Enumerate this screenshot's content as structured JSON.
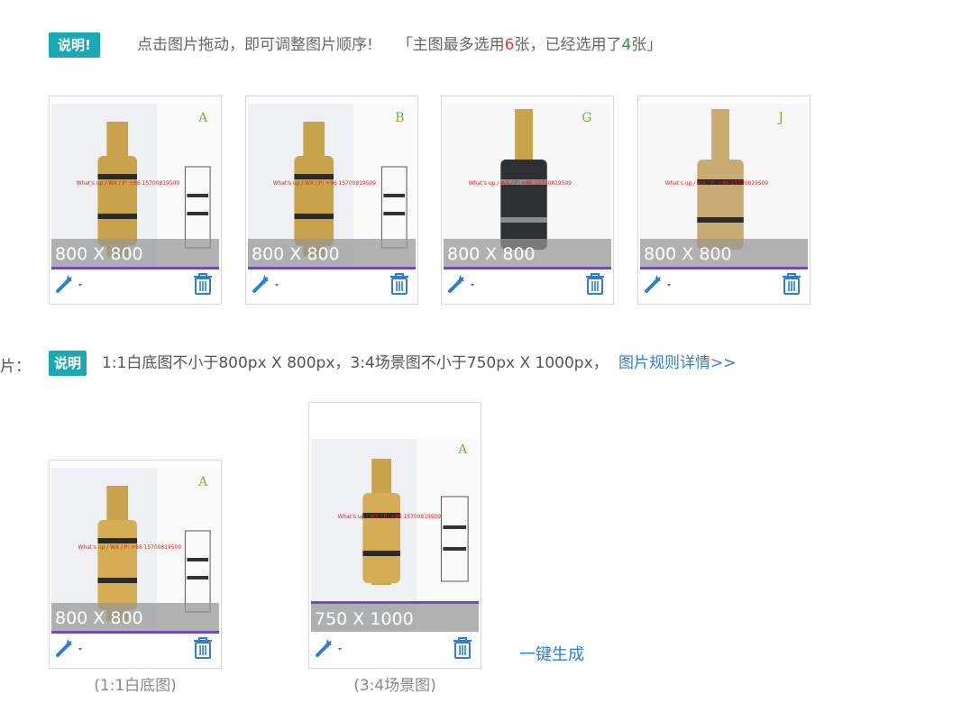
{
  "notice": {
    "badge": "说明!",
    "text": "点击图片拖动，即可调整图片顺序!",
    "range_prefix": "「主图最多选用",
    "max_count": "6",
    "range_mid": "张，已经选用了",
    "selected_count": "4",
    "range_suffix": "张」"
  },
  "main_images": [
    {
      "letter": "A",
      "size_label": "800 X 800",
      "product_color": "#c9a24c",
      "watermark": "What's up / WX / P: +86 15700819509"
    },
    {
      "letter": "B",
      "size_label": "800 X 800",
      "product_color": "#c9a24c",
      "watermark": "What's up / WX / P: +86 15700819509"
    },
    {
      "letter": "G",
      "size_label": "800 X 800",
      "product_color": "#2d3134",
      "watermark": "What's up / WX / P: +86 15700819509"
    },
    {
      "letter": "J",
      "size_label": "800 X 800",
      "product_color": "#c8ab72",
      "watermark": "What's up / WX / P: +86 15700819509"
    }
  ],
  "section2": {
    "label_fragment": "片：",
    "badge": "说明",
    "rule_text": "1:1白底图不小于800px X 800px，3:4场景图不小于750px X 1000px，",
    "rule_link": "图片规则详情>>"
  },
  "white_bg_image": {
    "letter": "A",
    "size_label": "800 X 800",
    "caption": "(1:1白底图)",
    "watermark": "What's up / WX / P: +86 15700819509"
  },
  "scene_image": {
    "letter": "A",
    "size_label": "750 X 1000",
    "caption": "(3:4场景图)",
    "watermark": "What's up / WX / P: +86 15700819509"
  },
  "generate_link": "一键生成",
  "colors": {
    "accent": "#1aa8b4",
    "link": "#2f7fd1",
    "highlight_red": "#e23b2c",
    "highlight_green": "#2a9b3d",
    "progress": "#6b4cc3"
  }
}
